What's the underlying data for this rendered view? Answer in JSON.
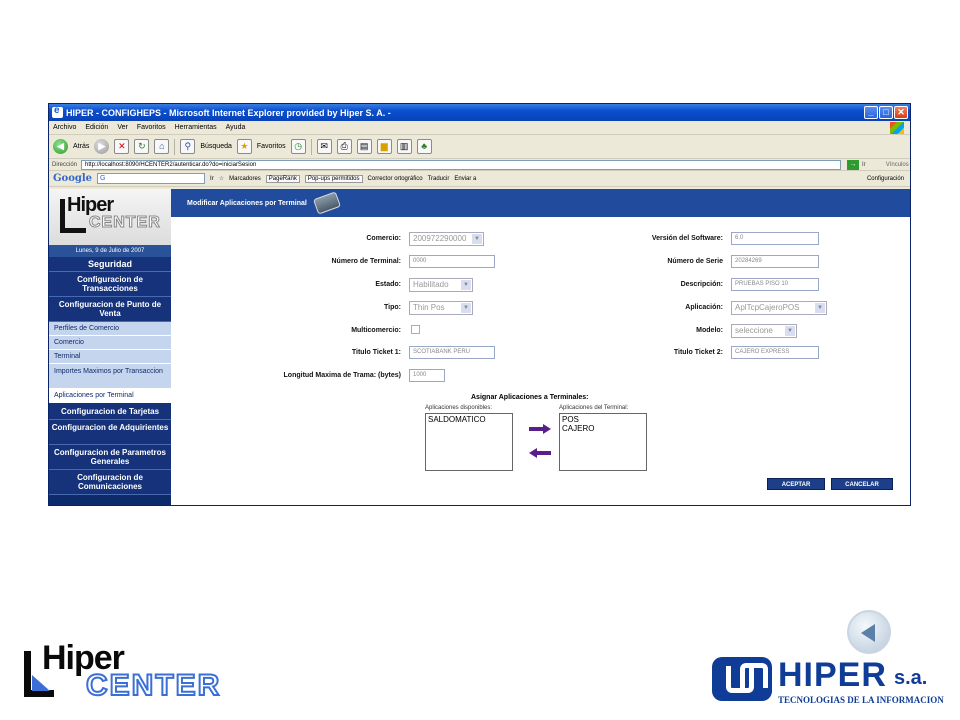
{
  "window": {
    "title": "HIPER - CONFIGHEPS - Microsoft Internet Explorer provided by Hiper S. A. -"
  },
  "menu": [
    "Archivo",
    "Edición",
    "Ver",
    "Favoritos",
    "Herramientas",
    "Ayuda"
  ],
  "toolbar": {
    "back_label": "Atrás",
    "search_label": "Búsqueda",
    "favorites_label": "Favoritos"
  },
  "address": {
    "label": "Dirección",
    "url": "http://localhost:8090/HCENTER2/autenticar.do?do=iniciarSesion",
    "go_label": "Ir",
    "links_label": "Vínculos"
  },
  "googlebar": {
    "logo": "Google",
    "field_value": "G",
    "ir_label": "Ir",
    "bookmarks_label": "Marcadores",
    "pagerank_label": "PageRank",
    "popups_label": "Pop-ups permitidos",
    "spell_label": "Corrector ortográfico",
    "translate_label": "Traducir",
    "send_label": "Enviar a",
    "config_label": "Configuración"
  },
  "sidebar": {
    "logo_top": "Hiper",
    "logo_bottom": "CENTER",
    "date": "Lunes, 9 de Julio de 2007",
    "items": [
      {
        "label": "Seguridad",
        "kind": "header"
      },
      {
        "label": "Configuracion de Transacciones",
        "kind": "header"
      },
      {
        "label": "Configuracion de Punto de Venta",
        "kind": "header"
      },
      {
        "label": "Perfiles de Comercio",
        "kind": "sub"
      },
      {
        "label": "Comercio",
        "kind": "sub"
      },
      {
        "label": "Terminal",
        "kind": "sub"
      },
      {
        "label": "Importes Maximos por Transaccion",
        "kind": "sub"
      },
      {
        "label": "Aplicaciones por Terminal",
        "kind": "sub-active"
      },
      {
        "label": "Configuracion de Tarjetas",
        "kind": "header"
      },
      {
        "label": "Configuracion de Adquirientes",
        "kind": "header"
      },
      {
        "label": "Configuracion de Parametros Generales",
        "kind": "header"
      },
      {
        "label": "Configuracion de Comunicaciones",
        "kind": "header"
      }
    ]
  },
  "page": {
    "title": "Modificar Aplicaciones por Terminal"
  },
  "form": {
    "comercio_label": "Comercio:",
    "comercio_value": "200972290000",
    "terminal_label": "Número de Terminal:",
    "terminal_value": "0000",
    "estado_label": "Estado:",
    "estado_value": "Habilitado",
    "tipo_label": "Tipo:",
    "tipo_value": "Thin Pos",
    "multicomercio_label": "Multicomercio:",
    "ticket1_label": "Titulo Ticket 1:",
    "ticket1_value": "SCOTIABANK PERU",
    "longitud_label": "Longitud Maxima de Trama: (bytes)",
    "longitud_value": "1000",
    "version_label": "Versión del Software:",
    "version_value": "6.0",
    "serie_label": "Número de Serie",
    "serie_value": "20284269",
    "descripcion_label": "Descripción:",
    "descripcion_value": "PRUEBAS PISO 10",
    "aplicacion_label": "Aplicación:",
    "aplicacion_value": "AplTcpCajeroPOS",
    "modelo_label": "Modelo:",
    "modelo_value": "seleccione",
    "ticket2_label": "Titulo Ticket 2:",
    "ticket2_value": "CAJERO EXPRESS"
  },
  "assign": {
    "title": "Asignar Aplicaciones a Terminales:",
    "available_label": "Aplicaciones disponibles:",
    "terminal_label": "Aplicaciones del Terminal:",
    "available": [
      "SALDOMATICO"
    ],
    "assigned": [
      "POS",
      "CAJERO"
    ]
  },
  "buttons": {
    "accept": "ACEPTAR",
    "cancel": "CANCELAR"
  },
  "footer": {
    "left_logo_top": "Hiper",
    "left_logo_bottom": "CENTER",
    "right_logo_name": "HIPER",
    "right_logo_suffix": "s.a.",
    "right_logo_tagline": "TECNOLOGIAS DE LA INFORMACION"
  },
  "colors": {
    "nav_dark": "#0d2a6b",
    "header_blue": "#214b9c",
    "arrow_purple": "#5a1e8c",
    "brand_blue": "#0f3c96"
  }
}
